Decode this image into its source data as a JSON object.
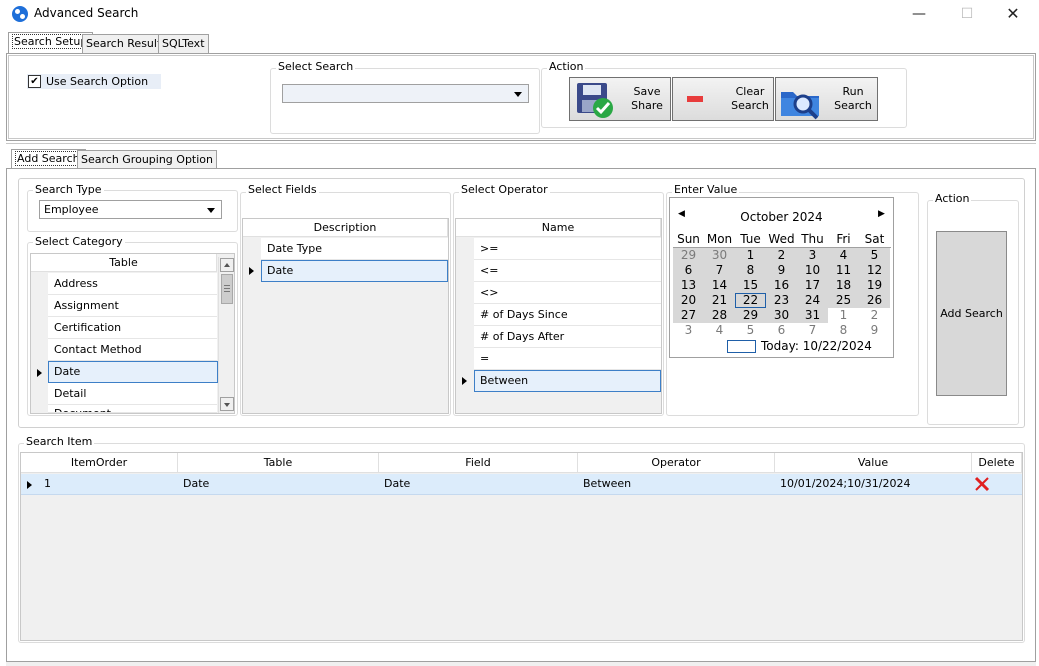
{
  "window": {
    "title": "Advanced Search",
    "min_glyph": "—",
    "max_glyph": "☐",
    "close_glyph": "✕"
  },
  "top_tabs": [
    {
      "label": "Search Setup",
      "active": true
    },
    {
      "label": "Search Result",
      "active": false
    },
    {
      "label": "SQLText",
      "active": false
    }
  ],
  "setup": {
    "use_search_option": {
      "label": "Use Search Option",
      "checked": true,
      "glyph": "✔"
    },
    "select_search": {
      "label": "Select Search",
      "value": ""
    },
    "action": {
      "label": "Action",
      "buttons": [
        {
          "label": "Save\nShare",
          "icon": "floppy-disk-check-icon"
        },
        {
          "label": "Clear\nSearch",
          "icon": "minus-icon"
        },
        {
          "label": "Run\nSearch",
          "icon": "folder-search-icon"
        }
      ]
    }
  },
  "inner_tabs": [
    {
      "label": "Add Search",
      "active": true
    },
    {
      "label": "Search Grouping Option",
      "active": false
    }
  ],
  "search_type": {
    "label": "Search Type",
    "value": "Employee"
  },
  "select_category": {
    "label": "Select Category",
    "column": "Table",
    "rows": [
      "Address",
      "Assignment",
      "Certification",
      "Contact Method",
      "Date",
      "Detail",
      "Document"
    ],
    "selected_index": 4
  },
  "select_fields": {
    "label": "Select Fields",
    "column": "Description",
    "rows": [
      "Date Type",
      "Date"
    ],
    "selected_index": 1
  },
  "select_operator": {
    "label": "Select Operator",
    "column": "Name",
    "rows": [
      ">=",
      "<=",
      "<>",
      "# of Days Since",
      "# of Days After",
      "=",
      "Between"
    ],
    "selected_index": 6
  },
  "enter_value": {
    "label": "Enter Value",
    "calendar": {
      "month_title": "October 2024",
      "prev_glyph": "◀",
      "next_glyph": "▶",
      "weekdays": [
        "Sun",
        "Mon",
        "Tue",
        "Wed",
        "Thu",
        "Fri",
        "Sat"
      ],
      "weeks": [
        [
          "29",
          "30",
          "1",
          "2",
          "3",
          "4",
          "5"
        ],
        [
          "6",
          "7",
          "8",
          "9",
          "10",
          "11",
          "12"
        ],
        [
          "13",
          "14",
          "15",
          "16",
          "17",
          "18",
          "19"
        ],
        [
          "20",
          "21",
          "22",
          "23",
          "24",
          "25",
          "26"
        ],
        [
          "27",
          "28",
          "29",
          "30",
          "31",
          "1",
          "2"
        ],
        [
          "3",
          "4",
          "5",
          "6",
          "7",
          "8",
          "9"
        ]
      ],
      "today_label": "Today: 10/22/2024",
      "selected_day": "22"
    }
  },
  "right_action": {
    "label": "Action",
    "button": "Add Search"
  },
  "search_item": {
    "label": "Search Item",
    "columns": [
      "ItemOrder",
      "Table",
      "Field",
      "Operator",
      "Value",
      "Delete"
    ],
    "rows": [
      {
        "item_order": "1",
        "table": "Date",
        "field": "Date",
        "operator": "Between",
        "value": "10/01/2024;10/31/2024",
        "delete_icon": "red-x-icon"
      }
    ]
  }
}
